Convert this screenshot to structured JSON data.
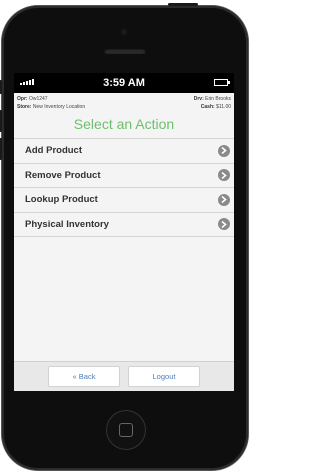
{
  "status": {
    "time": "3:59 AM"
  },
  "info": {
    "op_label": "Opr:",
    "op_value": "Ow1247",
    "drv_label": "Drv:",
    "drv_value": "Erin Brooks",
    "store_label": "Store:",
    "store_value": "New Inventory Location",
    "cash_label": "Cash:",
    "cash_value": "$11.00"
  },
  "title": "Select an Action",
  "actions": [
    {
      "label": "Add Product"
    },
    {
      "label": "Remove Product"
    },
    {
      "label": "Lookup Product"
    },
    {
      "label": "Physical Inventory"
    }
  ],
  "footer": {
    "back": "« Back",
    "logout": "Logout"
  },
  "colors": {
    "title": "#6cc06c",
    "link": "#4a7fb8"
  },
  "icons": [
    "signal-icon",
    "battery-icon",
    "chevron-right-icon",
    "home-button-icon"
  ]
}
